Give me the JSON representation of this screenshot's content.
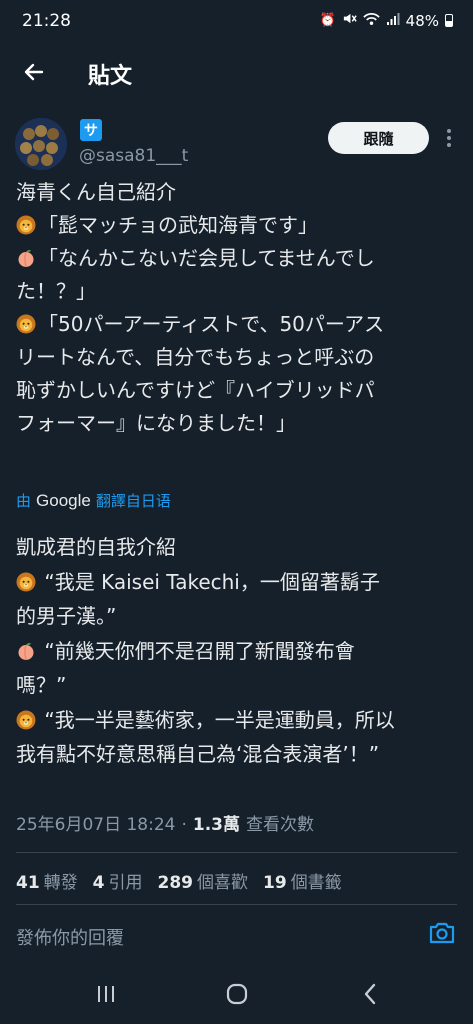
{
  "status_bar": {
    "time": "21:28",
    "battery": "48%",
    "icons": [
      "alarm-icon",
      "mute-icon",
      "wifi-icon",
      "signal-icon",
      "battery-icon"
    ]
  },
  "header": {
    "title": "貼文",
    "back_icon": "arrow-left-icon"
  },
  "author": {
    "badge": "サ",
    "handle": "@sasa81___t",
    "follow_label": "跟隨",
    "more_icon": "more-vertical-icon"
  },
  "post": {
    "lines": [
      {
        "emoji": "",
        "text": "海青くん自己紹介"
      },
      {
        "emoji": "lion-face-icon",
        "text": "「髭マッチョの武知海青です」"
      },
      {
        "emoji": "peach-icon",
        "text": "「なんかこないだ会見してませんでし"
      },
      {
        "emoji": "",
        "text": "た！？」"
      },
      {
        "emoji": "lion-face-icon",
        "text": "「50パーアーティストで、50パーアス"
      },
      {
        "emoji": "",
        "text": "リートなんで、自分でもちょっと呼ぶの"
      },
      {
        "emoji": "",
        "text": "恥ずかしいんですけど『ハイブリッドパ"
      },
      {
        "emoji": "",
        "text": "フォーマー』になりました！」"
      }
    ]
  },
  "translation": {
    "by": "由",
    "brand": "Google",
    "label": "翻譯自日语"
  },
  "translated": {
    "lines": [
      {
        "emoji": "",
        "text": "凱成君的自我介紹"
      },
      {
        "emoji": "lion-face-icon",
        "text": " “我是 Kaisei Takechi，一個留著鬍子"
      },
      {
        "emoji": "",
        "text": "的男子漢。”"
      },
      {
        "emoji": "peach-icon",
        "text": " “前幾天你們不是召開了新聞發布會"
      },
      {
        "emoji": "",
        "text": "嗎？”"
      },
      {
        "emoji": "lion-face-icon",
        "text": " “我一半是藝術家，一半是運動員，所以"
      },
      {
        "emoji": "",
        "text": "我有點不好意思稱自己為‘混合表演者’！”"
      }
    ]
  },
  "meta": {
    "timestamp": "25年6月07日 18:24",
    "separator": "·",
    "views": "1.3萬",
    "views_label": "查看次數"
  },
  "stats": [
    {
      "count": "41",
      "label": "轉發"
    },
    {
      "count": "4",
      "label": "引用"
    },
    {
      "count": "289",
      "label": "個喜歡"
    },
    {
      "count": "19",
      "label": "個書籤"
    }
  ],
  "reply": {
    "placeholder": "發佈你的回覆",
    "camera_icon": "camera-icon"
  },
  "nav_bar": {
    "icons": [
      "recent-apps-icon",
      "home-icon",
      "back-icon"
    ]
  },
  "colors": {
    "background": "#15202b",
    "accent": "#1d9bf0",
    "text": "#e7e9ea",
    "muted": "#8b98a5",
    "divider": "#38444d"
  }
}
